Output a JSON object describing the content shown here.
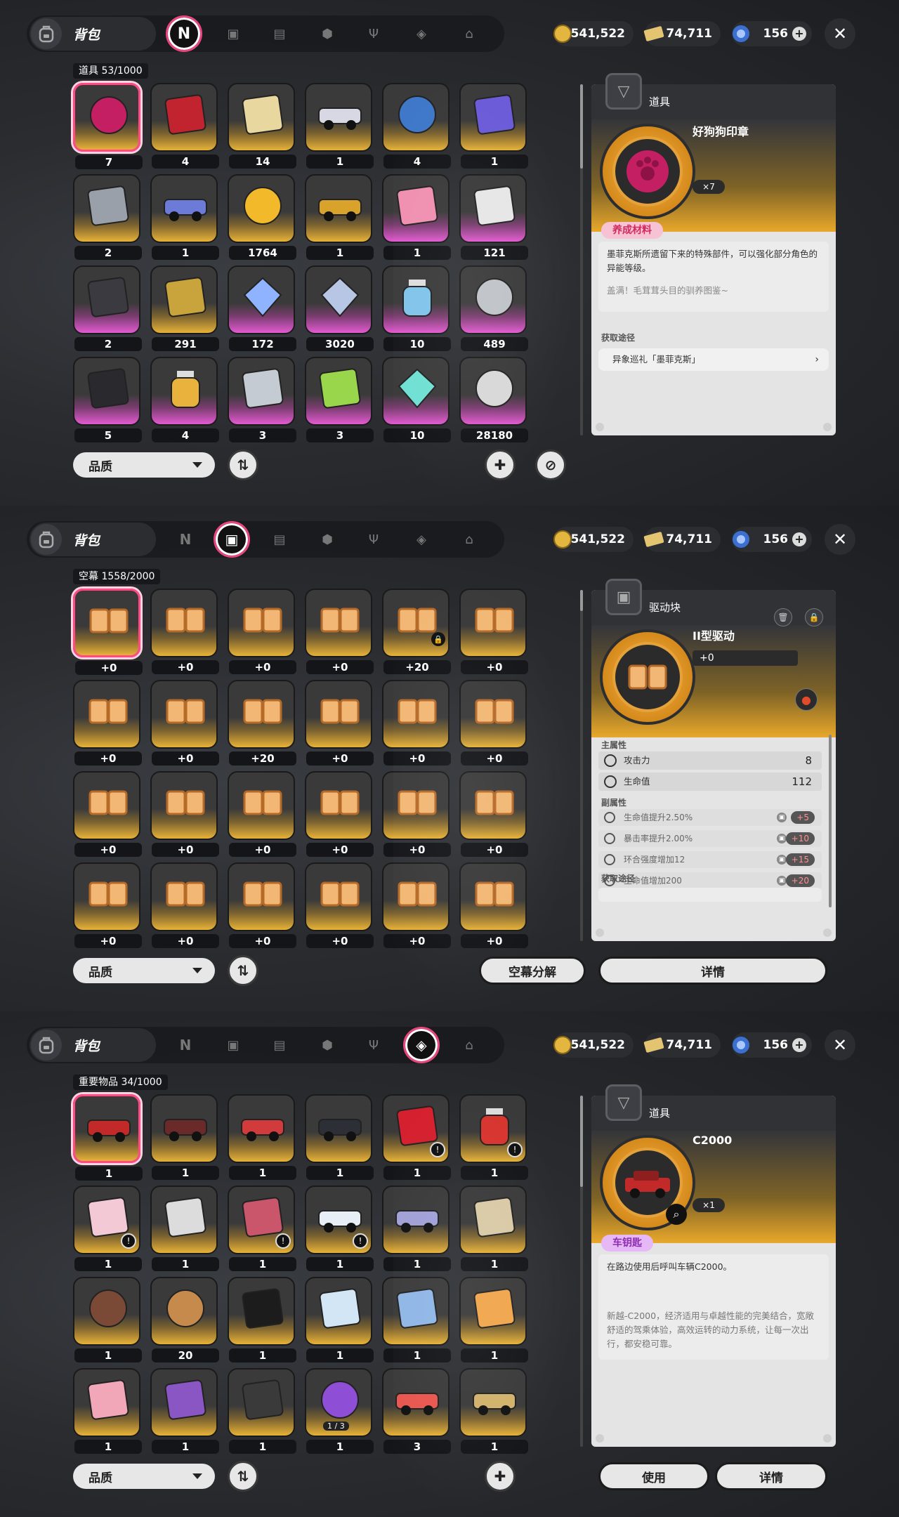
{
  "common": {
    "bag_title": "背包",
    "gold": "541,522",
    "tickets": "74,711",
    "gems": "156",
    "close": "✕",
    "quality_label": "品质",
    "accent": "#ff4a86"
  },
  "panel1": {
    "category_label": "道具  53/1000",
    "cells": [
      {
        "qty": "7",
        "color": "gold",
        "icon": "wax-seal-icon"
      },
      {
        "qty": "4",
        "color": "gold",
        "icon": "red-cloak-icon"
      },
      {
        "qty": "14",
        "color": "gold",
        "icon": "chess-piece-icon"
      },
      {
        "qty": "1",
        "color": "gold",
        "icon": "card-icon"
      },
      {
        "qty": "4",
        "color": "gold",
        "icon": "spool-icon"
      },
      {
        "qty": "1",
        "color": "gold",
        "icon": "sword-icon"
      },
      {
        "qty": "2",
        "color": "gold",
        "icon": "armor-icon"
      },
      {
        "qty": "1",
        "color": "gold",
        "icon": "hovercraft-icon"
      },
      {
        "qty": "1764",
        "color": "gold",
        "icon": "gold-coin-icon"
      },
      {
        "qty": "1",
        "color": "gold",
        "icon": "truck-icon"
      },
      {
        "qty": "1",
        "color": "purple",
        "icon": "gift-bag-icon"
      },
      {
        "qty": "121",
        "color": "purple",
        "icon": "documents-icon"
      },
      {
        "qty": "2",
        "color": "purple",
        "icon": "dark-book-icon"
      },
      {
        "qty": "291",
        "color": "gold",
        "icon": "circuit-box-icon"
      },
      {
        "qty": "172",
        "color": "purple",
        "icon": "crystal-icon"
      },
      {
        "qty": "3020",
        "color": "purple",
        "icon": "ice-crystal-icon"
      },
      {
        "qty": "10",
        "color": "purple",
        "icon": "potion-bottle-icon"
      },
      {
        "qty": "489",
        "color": "purple",
        "icon": "silver-spool-icon"
      },
      {
        "qty": "5",
        "color": "purple",
        "icon": "black-box-icon"
      },
      {
        "qty": "4",
        "color": "purple",
        "icon": "gold-flask-icon"
      },
      {
        "qty": "3",
        "color": "purple",
        "icon": "silver-armor-icon"
      },
      {
        "qty": "3",
        "color": "purple",
        "icon": "paint-bucket-icon"
      },
      {
        "qty": "10",
        "color": "purple",
        "icon": "prism-icon"
      },
      {
        "qty": "28180",
        "color": "purple",
        "icon": "silver-coin-icon"
      }
    ],
    "detail": {
      "type": "道具",
      "name": "好狗狗印章",
      "count": "×7",
      "tag": "养成材料",
      "desc": "墨菲克斯所遗留下来的特殊部件，可以强化部分角色的异能等级。",
      "flavor": "盖满！毛茸茸头目的驯养图鉴~",
      "source_label": "获取途径",
      "source": "异象巡礼「墨菲克斯」"
    }
  },
  "panel2": {
    "category_label": "空幕  1558/2000",
    "cells": [
      "+0",
      "+0",
      "+0",
      "+0",
      "+20",
      "+0",
      "+0",
      "+0",
      "+20",
      "+0",
      "+0",
      "+0",
      "+0",
      "+0",
      "+0",
      "+0",
      "+0",
      "+0",
      "+0",
      "+0",
      "+0",
      "+0",
      "+0",
      "+0"
    ],
    "locked_index": 4,
    "detail": {
      "type": "驱动块",
      "name": "II型驱动",
      "level": "+0",
      "main_label": "主属性",
      "main": [
        {
          "name": "攻击力",
          "value": "8"
        },
        {
          "name": "生命值",
          "value": "112"
        }
      ],
      "sub_label": "副属性",
      "subs": [
        {
          "name": "生命值提升2.50%",
          "plus": "+5"
        },
        {
          "name": "暴击率提升2.00%",
          "plus": "+10"
        },
        {
          "name": "环合强度增加12",
          "plus": "+15"
        },
        {
          "name": "生命值增加200",
          "plus": "+20"
        }
      ],
      "source_label": "获取途径"
    },
    "decompose_label": "空幕分解",
    "details_label": "详情"
  },
  "panel3": {
    "category_label": "重要物品  34/1000",
    "cells": [
      {
        "qty": "1",
        "icon": "red-car-icon"
      },
      {
        "qty": "1",
        "icon": "motorcycle-icon"
      },
      {
        "qty": "1",
        "icon": "scooter-icon"
      },
      {
        "qty": "1",
        "icon": "black-car-icon"
      },
      {
        "qty": "1",
        "icon": "rose-icon"
      },
      {
        "qty": "1",
        "icon": "drink-pouch-icon"
      },
      {
        "qty": "1",
        "icon": "ice-cream-icon"
      },
      {
        "qty": "1",
        "icon": "cloud-photo-icon"
      },
      {
        "qty": "1",
        "icon": "star-charm-icon"
      },
      {
        "qty": "1",
        "icon": "id-card-icon"
      },
      {
        "qty": "1",
        "icon": "character-card-icon"
      },
      {
        "qty": "1",
        "icon": "key-icon"
      },
      {
        "qty": "1",
        "icon": "wreath-icon"
      },
      {
        "qty": "20",
        "icon": "bronze-coin-icon"
      },
      {
        "qty": "1",
        "icon": "sunglasses-icon"
      },
      {
        "qty": "1",
        "icon": "supplies-icon"
      },
      {
        "qty": "1",
        "icon": "blueprint-icon"
      },
      {
        "qty": "1",
        "icon": "orange-photo-icon"
      },
      {
        "qty": "1",
        "icon": "cake-icon"
      },
      {
        "qty": "1",
        "icon": "music-player-icon"
      },
      {
        "qty": "1",
        "icon": "controller-icon"
      },
      {
        "qty": "1",
        "icon": "crystal-ball-icon"
      },
      {
        "qty": "3",
        "icon": "red-card-icon"
      },
      {
        "qty": "1",
        "icon": "gold-card-icon"
      }
    ],
    "orb_fraction": "1 / 3",
    "detail": {
      "type": "道具",
      "name": "C2000",
      "count": "×1",
      "tag": "车钥匙",
      "desc": "在路边使用后呼叫车辆C2000。",
      "flavor": "新越-C2000，经济适用与卓越性能的完美结合，宽敞舒适的驾乘体验，高效运转的动力系统，让每一次出行，都安稳可靠。"
    },
    "use_label": "使用",
    "details_label": "详情"
  }
}
